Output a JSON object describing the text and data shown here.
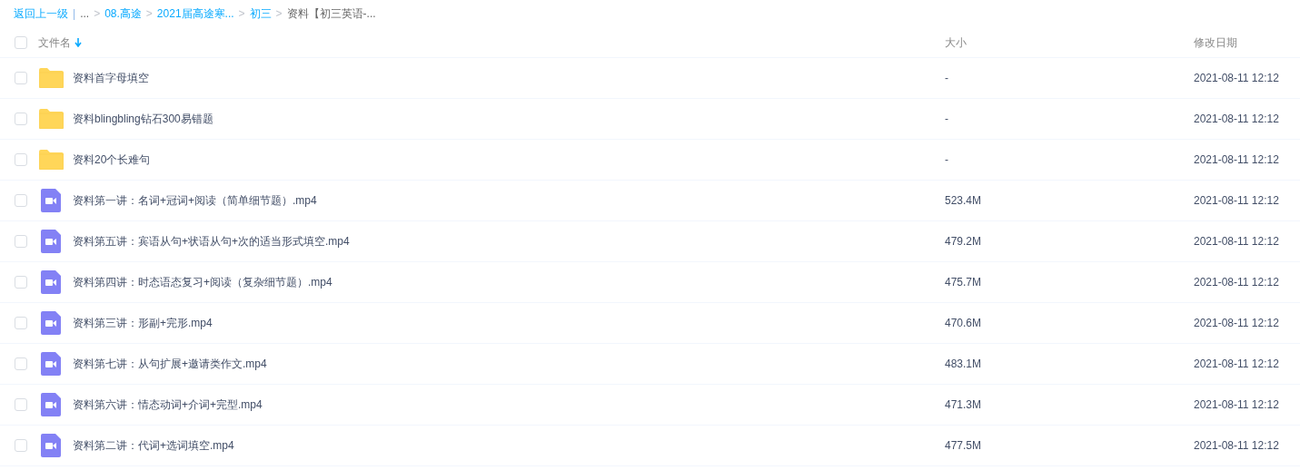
{
  "breadcrumb": {
    "back": "返回上一级",
    "divider": "|",
    "separator": ">",
    "items": [
      {
        "label": "...",
        "link": false
      },
      {
        "label": "08.高途",
        "link": true
      },
      {
        "label": "2021届高途寒...",
        "link": true
      },
      {
        "label": "初三",
        "link": true
      },
      {
        "label": "资料【初三英语-...",
        "link": false
      }
    ]
  },
  "table": {
    "select_all": {
      "checked": false
    },
    "columns": [
      {
        "label": "文件名",
        "sorted": true
      },
      {
        "label": "大小",
        "sorted": false
      },
      {
        "label": "修改日期",
        "sorted": false
      }
    ],
    "rows": [
      {
        "kind": "folder",
        "name": "资料首字母填空",
        "size": "-",
        "date": "2021-08-11 12:12",
        "checked": false
      },
      {
        "kind": "folder",
        "name": "资料blingbling钻石300易错题",
        "size": "-",
        "date": "2021-08-11 12:12",
        "checked": false
      },
      {
        "kind": "folder",
        "name": "资料20个长难句",
        "size": "-",
        "date": "2021-08-11 12:12",
        "checked": false
      },
      {
        "kind": "video",
        "name": "资料第一讲：名词+冠词+阅读（简单细节题）.mp4",
        "size": "523.4M",
        "date": "2021-08-11 12:12",
        "checked": false
      },
      {
        "kind": "video",
        "name": "资料第五讲：宾语从句+状语从句+次的适当形式填空.mp4",
        "size": "479.2M",
        "date": "2021-08-11 12:12",
        "checked": false
      },
      {
        "kind": "video",
        "name": "资料第四讲：时态语态复习+阅读（复杂细节题）.mp4",
        "size": "475.7M",
        "date": "2021-08-11 12:12",
        "checked": false
      },
      {
        "kind": "video",
        "name": "资料第三讲：形副+完形.mp4",
        "size": "470.6M",
        "date": "2021-08-11 12:12",
        "checked": false
      },
      {
        "kind": "video",
        "name": "资料第七讲：从句扩展+邀请类作文.mp4",
        "size": "483.1M",
        "date": "2021-08-11 12:12",
        "checked": false
      },
      {
        "kind": "video",
        "name": "资料第六讲：情态动词+介词+完型.mp4",
        "size": "471.3M",
        "date": "2021-08-11 12:12",
        "checked": false
      },
      {
        "kind": "video",
        "name": "资料第二讲：代词+选词填空.mp4",
        "size": "477.5M",
        "date": "2021-08-11 12:12",
        "checked": false
      }
    ]
  }
}
